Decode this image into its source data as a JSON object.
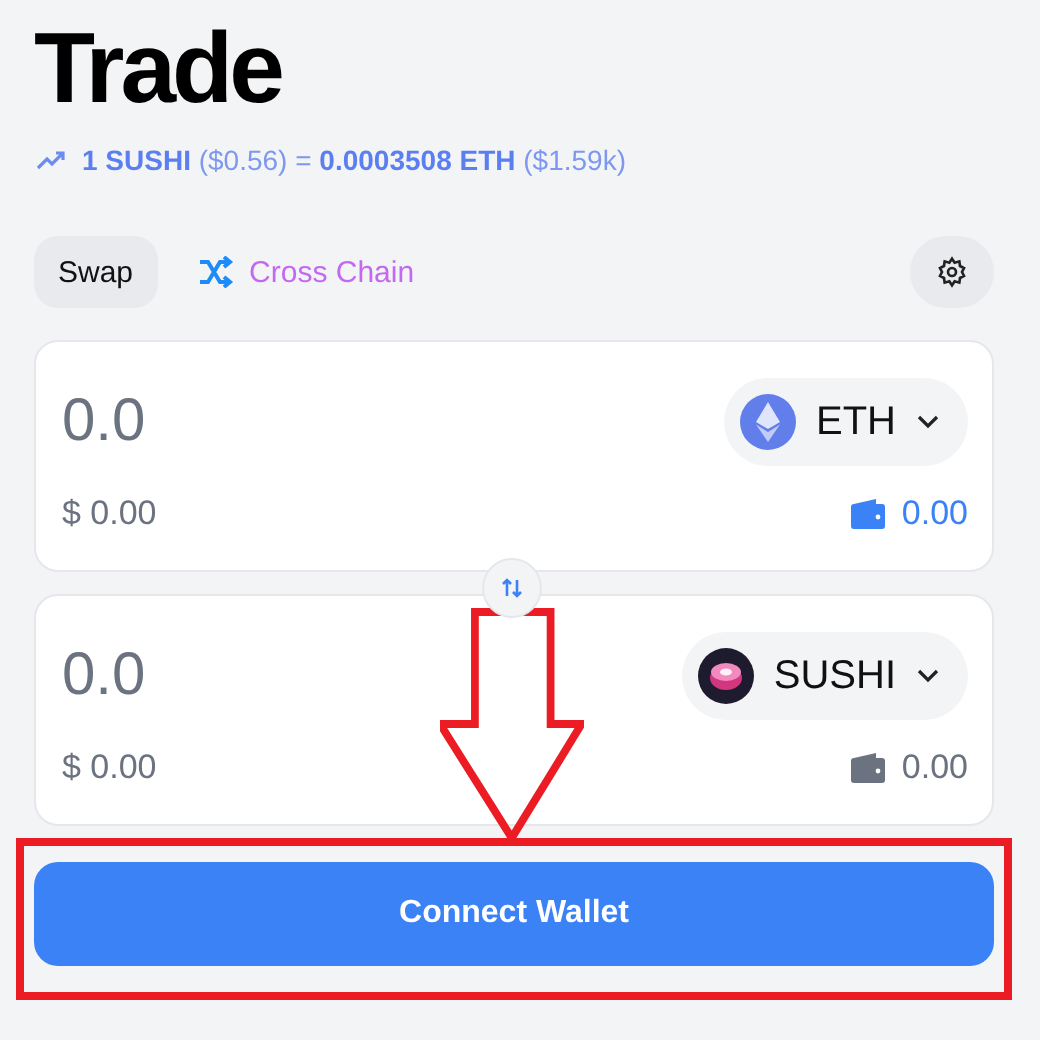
{
  "title": "Trade",
  "rate": "**1 SUSHI** ($0.56) = **0.0003508 ETH** ($1.59k)",
  "tabs": [
    {
      "label": "Swap",
      "selected": true
    },
    {
      "label": "Cross Chain",
      "selected": false
    }
  ],
  "cards": [
    {
      "amount": "0.0",
      "token": "ETH",
      "kind": "eth",
      "usd": "$ 0.00",
      "balance": "0.00",
      "color": "#3b82f6"
    },
    {
      "amount": "0.0",
      "token": "SUSHI",
      "kind": "sushi",
      "usd": "$ 0.00",
      "balance": "0.00",
      "color": "#6b7280"
    }
  ],
  "connect_button": "Connect Wallet"
}
